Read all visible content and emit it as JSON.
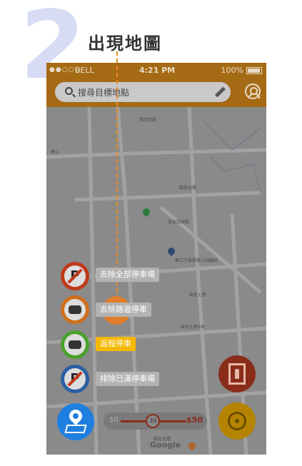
{
  "step": {
    "number": "2",
    "title": "出現地圖"
  },
  "statusbar": {
    "signal": "●●○○○",
    "carrier": "BELL",
    "time": "4:21 PM",
    "battery": "100%"
  },
  "search": {
    "placeholder": "搜尋目標地點"
  },
  "map": {
    "poi_1": "永安羽球館",
    "poi_2": "華江汽車駕駛人訓練班",
    "google": "Google",
    "road_labels": [
      "環河南路",
      "區莊北路",
      "區莊七巷",
      "區莊七巷2弄",
      "區莊北路",
      "華江"
    ]
  },
  "categories": [
    {
      "label": "去除全部停車場",
      "icon": "no-parking-icon"
    },
    {
      "label": "去除路邊停車",
      "icon": "roadside-car-icon"
    },
    {
      "label": "返程停車",
      "icon": "return-car-icon"
    },
    {
      "label": "排除已滿停車場",
      "icon": "full-parking-icon"
    }
  ],
  "slider": {
    "min_label": "$0",
    "value_label": "30",
    "max_label": "$50",
    "value": 30,
    "min": 0,
    "max": 50
  },
  "colors": {
    "accent": "#a56a14",
    "highlight": "#f5b800",
    "dash": "#f08a20",
    "step_number": "#d7dbf4"
  }
}
